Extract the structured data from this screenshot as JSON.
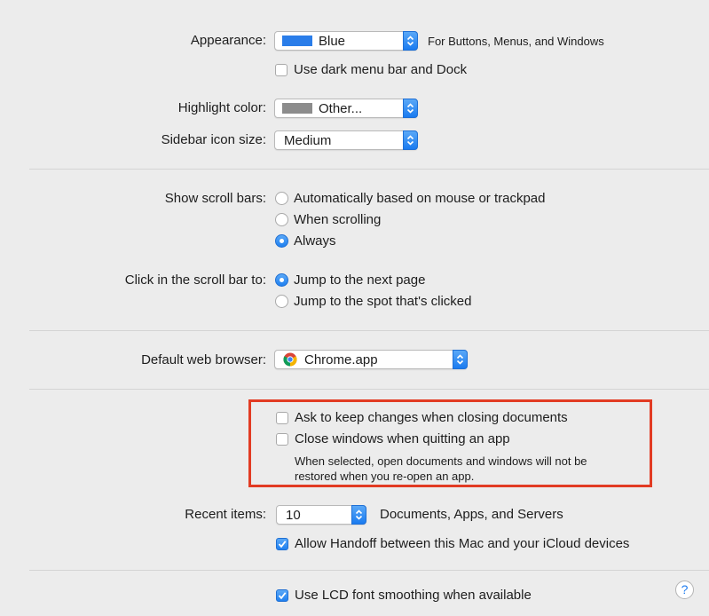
{
  "appearance": {
    "label": "Appearance:",
    "value": "Blue",
    "swatch_color": "#2a7de9",
    "description": "For Buttons, Menus, and Windows",
    "dark_menu_label": "Use dark menu bar and Dock",
    "dark_menu_checked": false
  },
  "highlight": {
    "label": "Highlight color:",
    "value": "Other...",
    "swatch_color": "#8c8c8c"
  },
  "sidebar": {
    "label": "Sidebar icon size:",
    "value": "Medium"
  },
  "scroll_bars": {
    "label": "Show scroll bars:",
    "options": [
      "Automatically based on mouse or trackpad",
      "When scrolling",
      "Always"
    ],
    "selected": "Always"
  },
  "click_scroll": {
    "label": "Click in the scroll bar to:",
    "options": [
      "Jump to the next page",
      "Jump to the spot that's clicked"
    ],
    "selected": "Jump to the next page"
  },
  "browser": {
    "label": "Default web browser:",
    "value": "Chrome.app",
    "icon": "chrome-icon"
  },
  "documents": {
    "ask_keep_label": "Ask to keep changes when closing documents",
    "ask_keep_checked": false,
    "close_windows_label": "Close windows when quitting an app",
    "close_windows_checked": false,
    "note_line1": "When selected, open documents and windows will not be",
    "note_line2": "restored when you re-open an app."
  },
  "recent": {
    "label": "Recent items:",
    "value": "10",
    "suffix": "Documents, Apps, and Servers",
    "handoff_label": "Allow Handoff between this Mac and your iCloud devices",
    "handoff_checked": true
  },
  "lcd": {
    "label": "Use LCD font smoothing when available",
    "checked": true
  },
  "help": {
    "symbol": "?"
  },
  "colors": {
    "accent": "#1f80f0",
    "annotation_box": "#e23b23"
  }
}
